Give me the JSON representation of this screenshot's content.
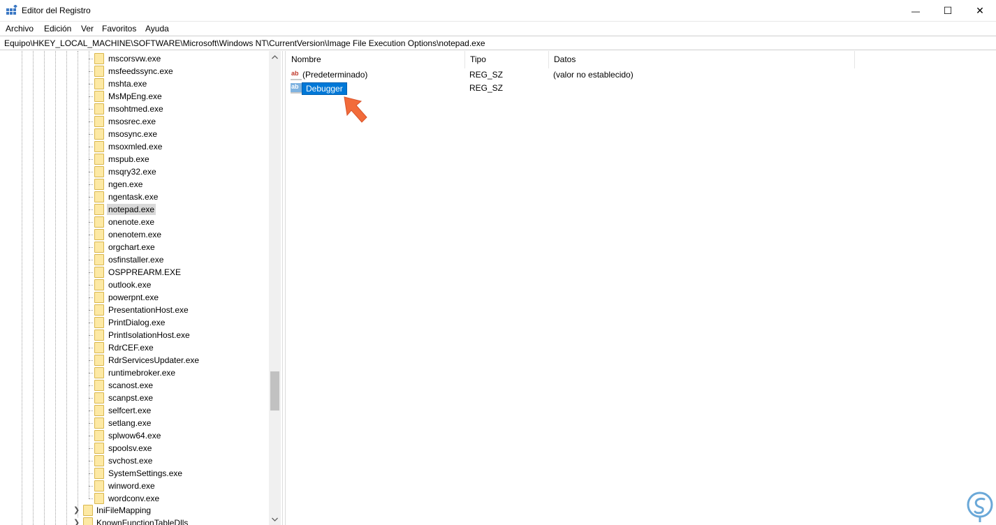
{
  "window": {
    "title": "Editor del Registro",
    "controls": {
      "minimize": "—",
      "maximize": "☐",
      "close": "✕"
    }
  },
  "menu": [
    "Archivo",
    "Edición",
    "Ver",
    "Favoritos",
    "Ayuda"
  ],
  "address": "Equipo\\HKEY_LOCAL_MACHINE\\SOFTWARE\\Microsoft\\Windows NT\\CurrentVersion\\Image File Execution Options\\notepad.exe",
  "tree": {
    "items": [
      "mscorsvw.exe",
      "msfeedssync.exe",
      "mshta.exe",
      "MsMpEng.exe",
      "msohtmed.exe",
      "msosrec.exe",
      "msosync.exe",
      "msoxmled.exe",
      "mspub.exe",
      "msqry32.exe",
      "ngen.exe",
      "ngentask.exe",
      "notepad.exe",
      "onenote.exe",
      "onenotem.exe",
      "orgchart.exe",
      "osfinstaller.exe",
      "OSPPREARM.EXE",
      "outlook.exe",
      "powerpnt.exe",
      "PresentationHost.exe",
      "PrintDialog.exe",
      "PrintIsolationHost.exe",
      "RdrCEF.exe",
      "RdrServicesUpdater.exe",
      "runtimebroker.exe",
      "scanost.exe",
      "scanpst.exe",
      "selfcert.exe",
      "setlang.exe",
      "splwow64.exe",
      "spoolsv.exe",
      "svchost.exe",
      "SystemSettings.exe",
      "winword.exe",
      "wordconv.exe"
    ],
    "selected": "notepad.exe",
    "parent_items": [
      "IniFileMapping",
      "KnownFunctionTableDlls"
    ]
  },
  "list": {
    "columns": [
      "Nombre",
      "Tipo",
      "Datos"
    ],
    "rows": [
      {
        "name": "(Predeterminado)",
        "type": "REG_SZ",
        "data": "(valor no establecido)",
        "icon": "string-value-icon",
        "editing": false
      },
      {
        "name": "Debugger",
        "type": "REG_SZ",
        "data": "",
        "icon": "string-value-icon",
        "editing": true
      }
    ]
  },
  "colors": {
    "selection": "#0078d7",
    "arrow": "#f26b3a",
    "logo": "#6aa8d8"
  }
}
